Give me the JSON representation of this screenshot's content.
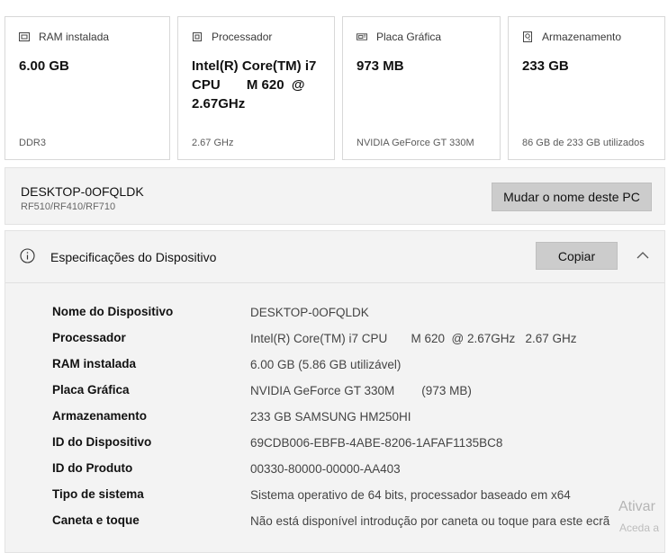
{
  "cards": [
    {
      "icon": "ram-icon",
      "label": "RAM instalada",
      "value": "6.00 GB",
      "detail": "DDR3"
    },
    {
      "icon": "processor-icon",
      "label": "Processador",
      "value": "Intel(R) Core(TM) i7\nCPU       M 620  @\n2.67GHz",
      "detail": "2.67 GHz"
    },
    {
      "icon": "graphics-card-icon",
      "label": "Placa Gráfica",
      "value": "973 MB",
      "detail": "NVIDIA GeForce GT 330M"
    },
    {
      "icon": "storage-icon",
      "label": "Armazenamento",
      "value": "233 GB",
      "detail": "86 GB de 233 GB utilizados"
    }
  ],
  "device": {
    "name": "DESKTOP-0OFQLDK",
    "model": "RF510/RF410/RF710",
    "rename_label": "Mudar o nome deste PC"
  },
  "specs": {
    "title": "Especificações do Dispositivo",
    "copy_label": "Copiar",
    "rows": [
      {
        "key": "Nome do Dispositivo",
        "value": "DESKTOP-0OFQLDK"
      },
      {
        "key": "Processador",
        "value": "Intel(R) Core(TM) i7 CPU       M 620  @ 2.67GHz   2.67 GHz"
      },
      {
        "key": "RAM instalada",
        "value": "6.00 GB (5.86 GB utilizável)"
      },
      {
        "key": "Placa Gráfica",
        "value": "NVIDIA GeForce GT 330M        (973 MB)"
      },
      {
        "key": "Armazenamento",
        "value": "233 GB SAMSUNG HM250HI"
      },
      {
        "key": "ID do Dispositivo",
        "value": "69CDB006-EBFB-4ABE-8206-1AFAF1135BC8"
      },
      {
        "key": "ID do Produto",
        "value": "00330-80000-00000-AA403"
      },
      {
        "key": "Tipo de sistema",
        "value": "Sistema operativo de 64 bits, processador baseado em x64"
      },
      {
        "key": "Caneta e toque",
        "value": "Não está disponível introdução por caneta ou toque para este ecrã"
      }
    ]
  },
  "watermark": {
    "line1": "Ativar",
    "line2": "Aceda a"
  }
}
